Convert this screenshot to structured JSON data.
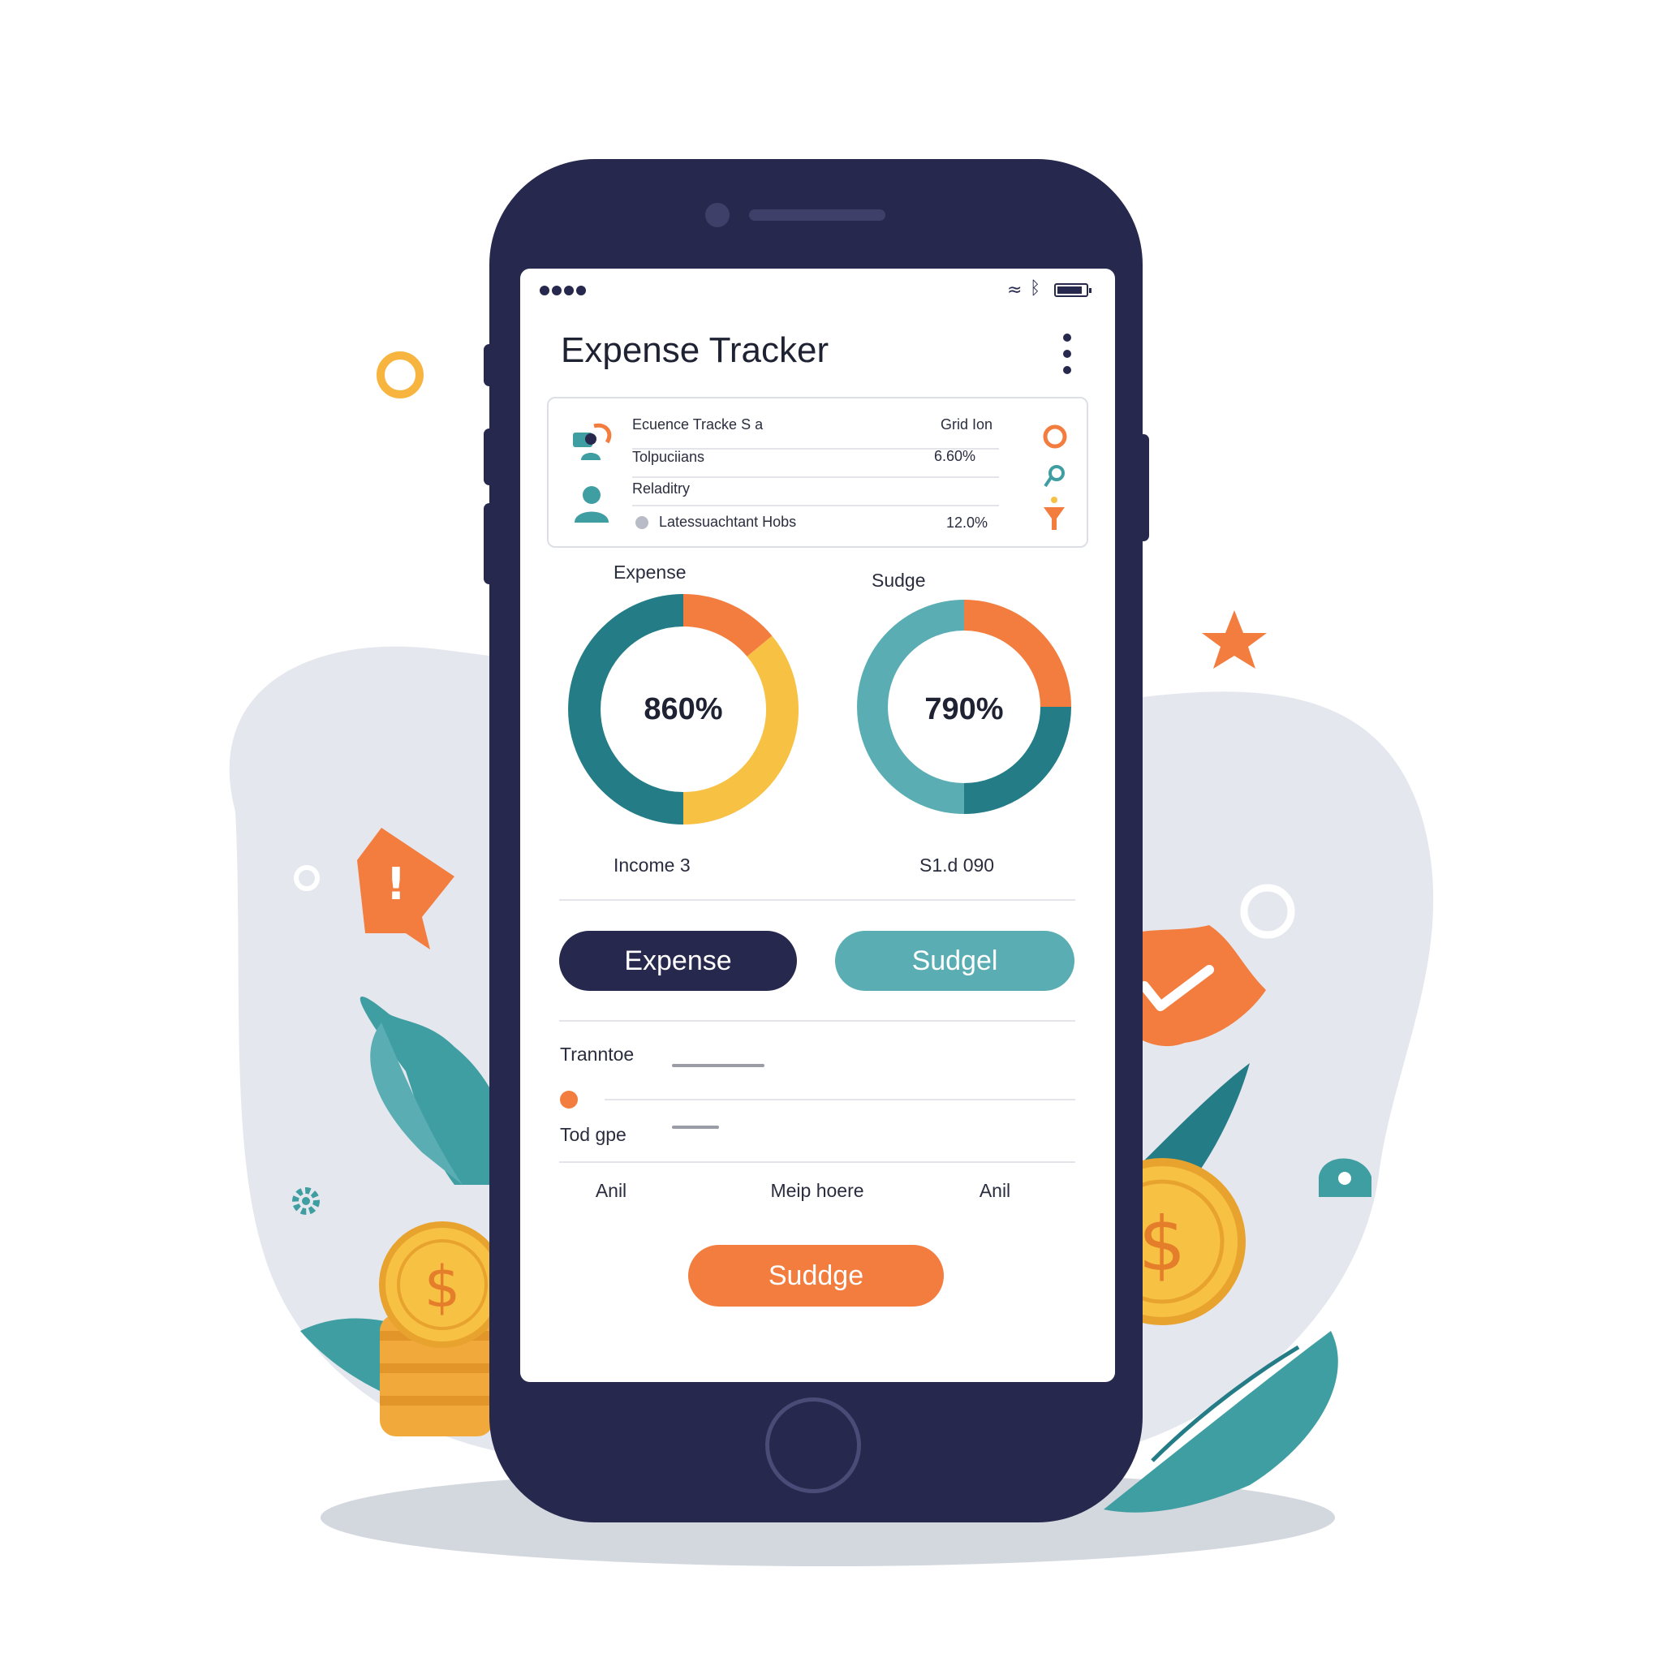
{
  "app": {
    "title": "Expense Tracker",
    "menu_icon": "more-vertical-icon",
    "status_icons": [
      "signal-dots-icon",
      "wifi-icon",
      "bluetooth-icon",
      "battery-icon"
    ]
  },
  "summary": {
    "header_left": "Ecuence Tracke S a",
    "header_right": "Grid Ion",
    "rows": [
      {
        "label": "Tolpuciians",
        "value": "6.60%"
      },
      {
        "label": "Reladitry",
        "value": ""
      },
      {
        "label": "Latessuachtant Hobs",
        "value": "12.0%"
      }
    ],
    "left_icons": [
      "money-person-icon",
      "person-icon"
    ],
    "right_icons": [
      "ring-icon",
      "link-icon",
      "funnel-icon"
    ]
  },
  "chart_data": [
    {
      "type": "pie",
      "title": "Expense",
      "center_label": "860%",
      "footer": "Income 3",
      "slices": [
        {
          "value": 0.14,
          "color": "#f27d3f"
        },
        {
          "value": 0.36,
          "color": "#f7c144"
        },
        {
          "value": 0.5,
          "color": "#237c86"
        }
      ]
    },
    {
      "type": "pie",
      "title": "Sudge",
      "center_label": "790%",
      "footer": "S1.d 090",
      "slices": [
        {
          "value": 0.25,
          "color": "#f27d3f"
        },
        {
          "value": 0.25,
          "color": "#237c86"
        },
        {
          "value": 0.5,
          "color": "#5aaeb3"
        }
      ]
    }
  ],
  "buttons": {
    "expense": "Expense",
    "budget": "Sudgel",
    "submit": "Suddge"
  },
  "form": {
    "field1_label": "Tranntoe",
    "field2_label": "Tod gpe"
  },
  "footer_tabs": [
    "Anil",
    "Meip hoere",
    "Anil"
  ],
  "colors": {
    "navy": "#27284d",
    "teal": "#5aaeb3",
    "dark_teal": "#237c86",
    "orange": "#f27d3f",
    "yellow": "#f7c144"
  }
}
